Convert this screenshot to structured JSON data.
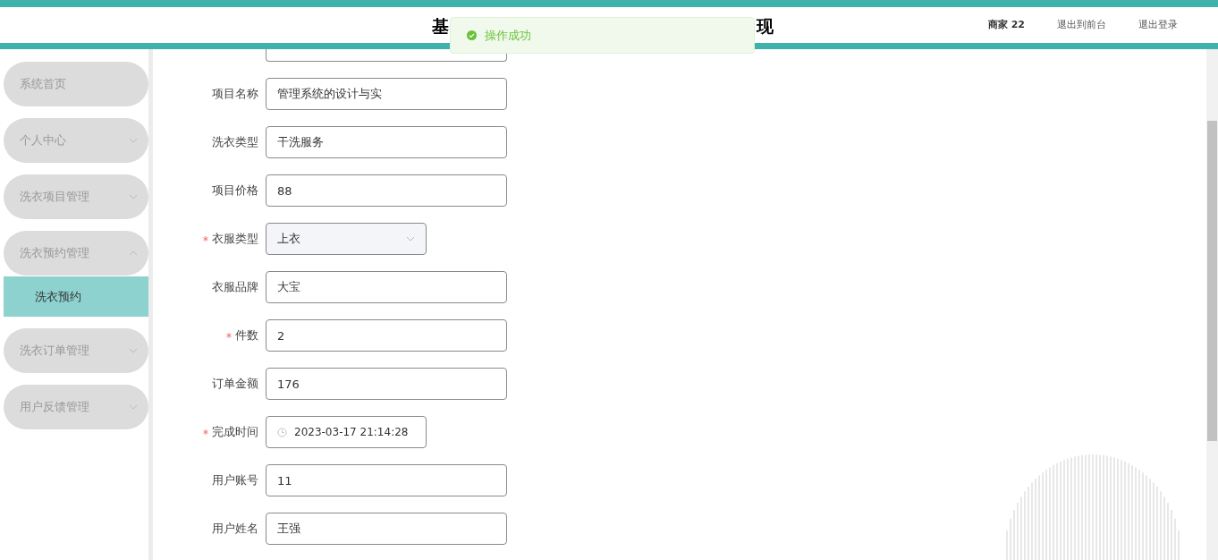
{
  "header": {
    "title_start": "基",
    "title_end": "现",
    "user": "商家 22",
    "links": [
      "退出到前台",
      "退出登录"
    ]
  },
  "toast": {
    "kind": "success",
    "text": "操作成功"
  },
  "sidebar": {
    "items": [
      {
        "label": "系统首页"
      },
      {
        "label": "个人中心",
        "expanded": false
      },
      {
        "label": "洗衣项目管理",
        "expanded": false
      },
      {
        "label": "洗衣预约管理",
        "expanded": true,
        "children": [
          {
            "label": "洗衣预约",
            "selected": true
          }
        ]
      },
      {
        "label": "洗衣订单管理",
        "expanded": false
      },
      {
        "label": "用户反馈管理",
        "expanded": false
      }
    ]
  },
  "form": {
    "fields": [
      {
        "kind": "cut"
      },
      {
        "kind": "text",
        "label": "项目名称",
        "required": false,
        "value": "管理系统的设计与实"
      },
      {
        "kind": "text",
        "label": "洗衣类型",
        "required": false,
        "value": "干洗服务"
      },
      {
        "kind": "text",
        "label": "项目价格",
        "required": false,
        "value": "88"
      },
      {
        "kind": "select",
        "label": "衣服类型",
        "required": true,
        "value": "上衣"
      },
      {
        "kind": "text",
        "label": "衣服品牌",
        "required": false,
        "value": "大宝"
      },
      {
        "kind": "text",
        "label": "件数",
        "required": true,
        "value": "2"
      },
      {
        "kind": "text",
        "label": "订单金额",
        "required": false,
        "value": "176"
      },
      {
        "kind": "date",
        "label": "完成时间",
        "required": true,
        "value": "2023-03-17 21:14:28"
      },
      {
        "kind": "text",
        "label": "用户账号",
        "required": false,
        "value": "11"
      },
      {
        "kind": "text",
        "label": "用户姓名",
        "required": false,
        "value": "王强"
      }
    ]
  }
}
